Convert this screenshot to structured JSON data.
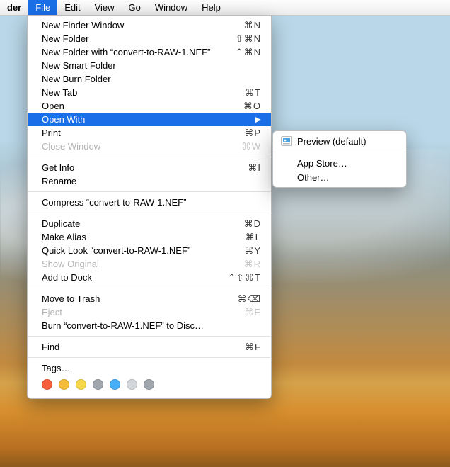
{
  "menubar": {
    "app": "der",
    "items": [
      "File",
      "Edit",
      "View",
      "Go",
      "Window",
      "Help"
    ],
    "activeIndex": 0
  },
  "menu": {
    "groups": [
      [
        {
          "label": "New Finder Window",
          "shortcut": "⌘N",
          "enabled": true
        },
        {
          "label": "New Folder",
          "shortcut": "⇧⌘N",
          "enabled": true
        },
        {
          "label": "New Folder with “convert-to-RAW-1.NEF”",
          "shortcut": "⌃⌘N",
          "enabled": true
        },
        {
          "label": "New Smart Folder",
          "shortcut": "",
          "enabled": true
        },
        {
          "label": "New Burn Folder",
          "shortcut": "",
          "enabled": true
        },
        {
          "label": "New Tab",
          "shortcut": "⌘T",
          "enabled": true
        },
        {
          "label": "Open",
          "shortcut": "⌘O",
          "enabled": true
        },
        {
          "label": "Open With",
          "shortcut": "",
          "enabled": true,
          "submenu": true,
          "highlight": true
        },
        {
          "label": "Print",
          "shortcut": "⌘P",
          "enabled": true
        },
        {
          "label": "Close Window",
          "shortcut": "⌘W",
          "enabled": false
        }
      ],
      [
        {
          "label": "Get Info",
          "shortcut": "⌘I",
          "enabled": true
        },
        {
          "label": "Rename",
          "shortcut": "",
          "enabled": true
        }
      ],
      [
        {
          "label": "Compress “convert-to-RAW-1.NEF”",
          "shortcut": "",
          "enabled": true
        }
      ],
      [
        {
          "label": "Duplicate",
          "shortcut": "⌘D",
          "enabled": true
        },
        {
          "label": "Make Alias",
          "shortcut": "⌘L",
          "enabled": true
        },
        {
          "label": "Quick Look “convert-to-RAW-1.NEF”",
          "shortcut": "⌘Y",
          "enabled": true
        },
        {
          "label": "Show Original",
          "shortcut": "⌘R",
          "enabled": false
        },
        {
          "label": "Add to Dock",
          "shortcut": "⌃⇧⌘T",
          "enabled": true
        }
      ],
      [
        {
          "label": "Move to Trash",
          "shortcut": "⌘⌫",
          "enabled": true
        },
        {
          "label": "Eject",
          "shortcut": "⌘E",
          "enabled": false
        },
        {
          "label": "Burn “convert-to-RAW-1.NEF” to Disc…",
          "shortcut": "",
          "enabled": true
        }
      ],
      [
        {
          "label": "Find",
          "shortcut": "⌘F",
          "enabled": true
        }
      ],
      [
        {
          "label": "Tags…",
          "shortcut": "",
          "enabled": true,
          "tags": true
        }
      ]
    ],
    "tagColors": [
      "#f55f3b",
      "#f6bd3a",
      "#f6d84a",
      "#9fa6ad",
      "#46aef7",
      "#d3d7db",
      "#9fa6ad"
    ]
  },
  "submenu": {
    "items": [
      {
        "label": "Preview (default)",
        "icon": "preview"
      },
      {
        "label": "App Store…",
        "icon": null
      },
      {
        "label": "Other…",
        "icon": null
      }
    ],
    "sepAfter": 0
  }
}
